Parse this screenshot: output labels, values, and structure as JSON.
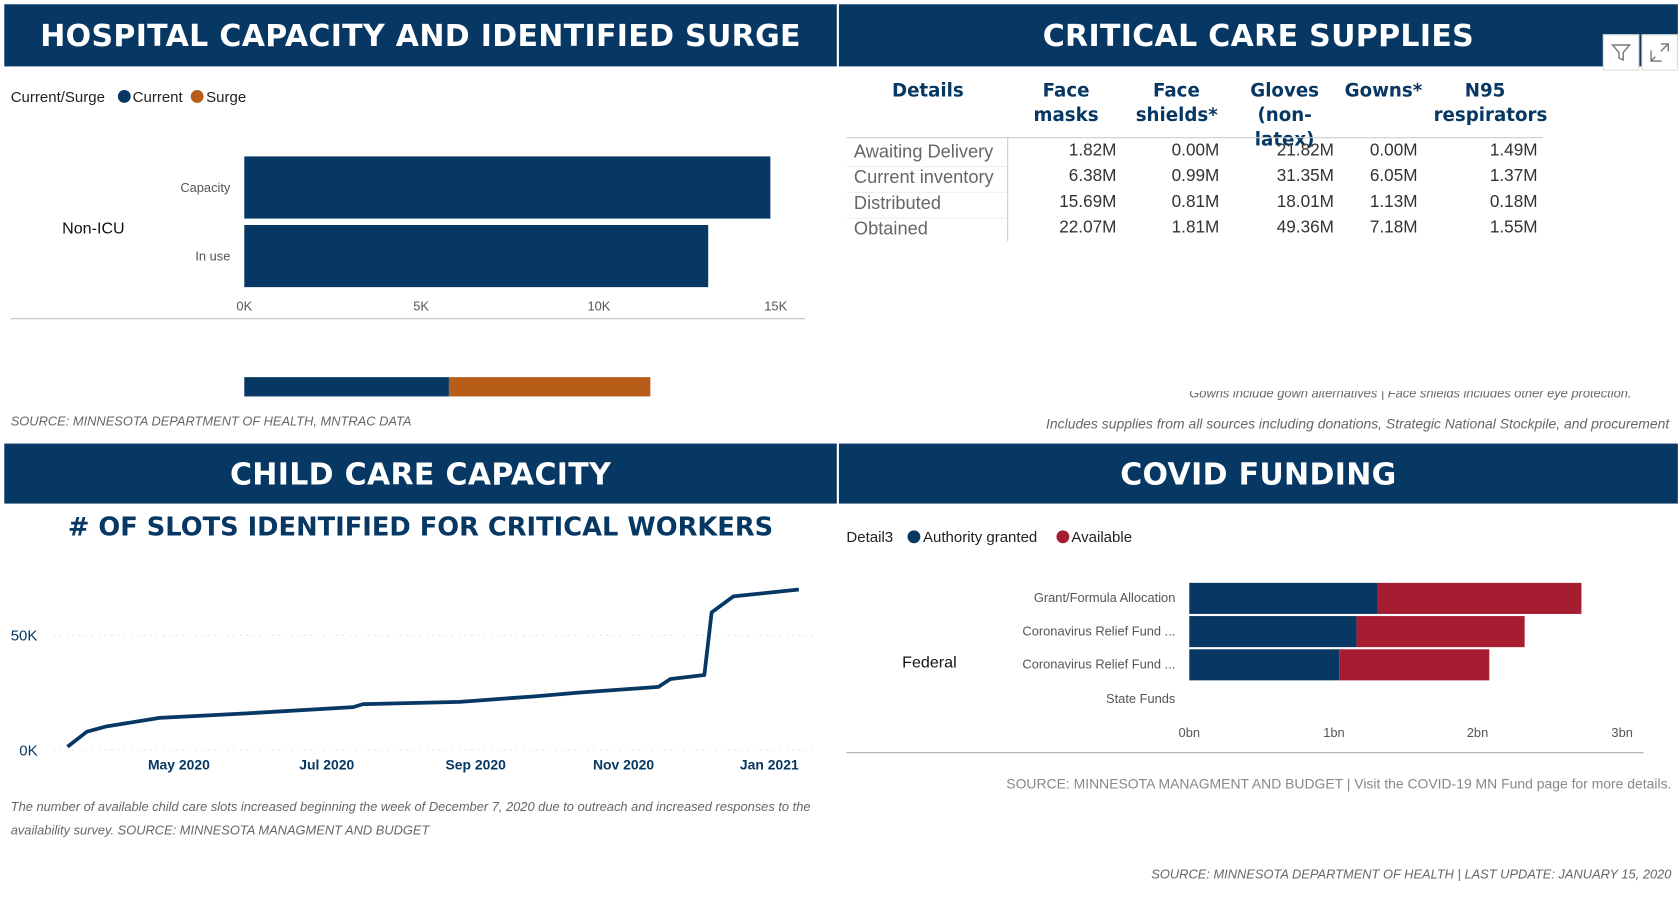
{
  "hospital": {
    "title": "HOSPITAL CAPACITY AND IDENTIFIED SURGE",
    "legend_title": "Current/Surge",
    "legend": [
      {
        "label": "Current",
        "color": "#073763"
      },
      {
        "label": "Surge",
        "color": "#b85c19"
      }
    ],
    "group": "Non-ICU",
    "source": "SOURCE: MINNESOTA DEPARTMENT OF HEALTH, MNTRAC DATA",
    "chart_data": {
      "type": "bar",
      "orientation": "horizontal",
      "categories": [
        "Capacity",
        "In use"
      ],
      "values": [
        14850,
        13100
      ],
      "unit": "beds",
      "xlim": [
        0,
        15000
      ],
      "xticks": [
        "0K",
        "5K",
        "10K",
        "15K"
      ],
      "color": "#073763"
    }
  },
  "supplies": {
    "title": "CRITICAL CARE SUPPLIES",
    "columns": [
      "Details",
      "Face masks",
      "Face shields*",
      "Gloves (non-latex)",
      "Gowns*",
      "N95 respirators"
    ],
    "rows": [
      [
        "Awaiting Delivery",
        "1.82M",
        "0.00M",
        "21.82M",
        "0.00M",
        "1.49M"
      ],
      [
        "Current inventory",
        "6.38M",
        "0.99M",
        "31.35M",
        "6.05M",
        "1.37M"
      ],
      [
        "Distributed",
        "15.69M",
        "0.81M",
        "18.01M",
        "1.13M",
        "0.18M"
      ],
      [
        "Obtained",
        "22.07M",
        "1.81M",
        "49.36M",
        "7.18M",
        "1.55M"
      ]
    ],
    "footnote": "Gowns include gown alternatives | Face shields includes other eye protection.",
    "note": "Includes supplies from all sources including donations, Strategic National Stockpile, and procurement",
    "icons": [
      "filter-icon",
      "focus-mode-icon"
    ]
  },
  "childcare": {
    "title": "CHILD CARE CAPACITY",
    "chart_data": {
      "type": "line",
      "title": "# OF SLOTS IDENTIFIED FOR CRITICAL WORKERS",
      "xticks": [
        "May 2020",
        "Jul 2020",
        "Sep 2020",
        "Nov 2020",
        "Jan 2021"
      ],
      "yticks": [
        "0K",
        "50K"
      ],
      "ylim": [
        0,
        70000
      ],
      "color": "#073763",
      "x": [
        "2020-03-16",
        "2020-03-24",
        "2020-04-01",
        "2020-04-23",
        "2020-05-29",
        "2020-07-12",
        "2020-07-16",
        "2020-08-25",
        "2020-09-25",
        "2020-10-13",
        "2020-11-15",
        "2020-11-20",
        "2020-12-04",
        "2020-12-07",
        "2020-12-16",
        "2021-01-12"
      ],
      "y": [
        1400,
        8000,
        10300,
        14000,
        16000,
        18700,
        20000,
        21000,
        23400,
        25000,
        27500,
        31000,
        32700,
        60000,
        67000,
        70000
      ]
    },
    "caption": "The number of available child care slots increased beginning the week of December 7, 2020 due to outreach and increased responses to the availability survey. SOURCE: MINNESOTA MANAGMENT AND BUDGET"
  },
  "funding": {
    "title": "COVID FUNDING",
    "legend_title": "Detail3",
    "group": "Federal",
    "source": "SOURCE: MINNESOTA MANAGMENT AND BUDGET | Visit the COVID-19 MN Fund page for more details.",
    "chart_data": {
      "type": "bar",
      "stacked": true,
      "orientation": "horizontal",
      "categories": [
        "Grant/Formula Allocation",
        "Coronavirus Relief Fund ...",
        "Coronavirus Relief Fund ...",
        "State Funds"
      ],
      "series": [
        {
          "name": "Authority granted",
          "color": "#073763",
          "values": [
            1.31,
            1.16,
            1.04,
            0
          ]
        },
        {
          "name": "Available",
          "color": "#a61c30",
          "values": [
            1.41,
            1.16,
            1.04,
            0
          ]
        }
      ],
      "xlim": [
        0,
        3
      ],
      "xticks": [
        "0bn",
        "1bn",
        "2bn",
        "3bn"
      ]
    }
  },
  "footer": "SOURCE: MINNESOTA DEPARTMENT OF HEALTH | LAST UPDATE: JANUARY 15, 2020"
}
